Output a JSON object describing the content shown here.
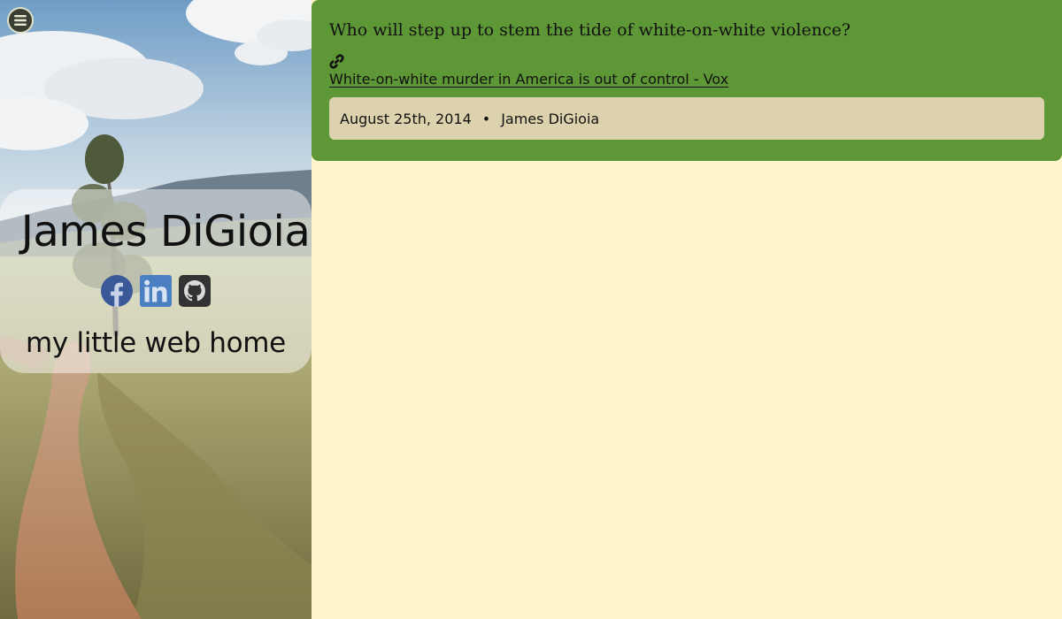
{
  "sidebar": {
    "menu_icon": "hamburger-menu-icon",
    "site_name": "James DiGioia",
    "tagline": "my little web home",
    "social": [
      {
        "icon": "facebook-icon",
        "color": "#3b5998"
      },
      {
        "icon": "linkedin-icon",
        "color": "#4a7fc1"
      },
      {
        "icon": "github-icon",
        "color": "#333333"
      }
    ]
  },
  "post": {
    "title": "Who will step up to stem the tide of white-on-white violence?",
    "link_icon": "link-icon",
    "link_text": "White-on-white murder in America is out of control - Vox",
    "date": "August 25th, 2014",
    "separator": "•",
    "author": "James DiGioia"
  },
  "colors": {
    "page_background": "#fff5cc",
    "post_card": "#5e9736",
    "meta_bar": "#dcd3ae"
  }
}
